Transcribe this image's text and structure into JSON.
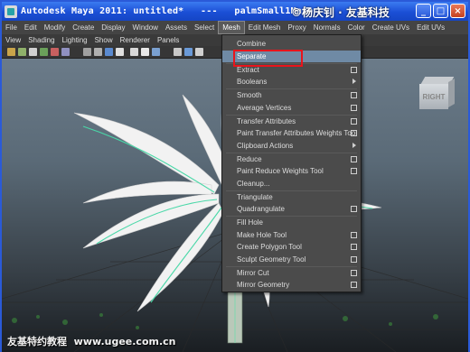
{
  "window": {
    "title": "Autodesk Maya 2011: untitled*   ---   palmSmall1Main",
    "watermark_top": "©杨庆钊 · 友基科技",
    "buttons": [
      "_",
      "□",
      "×"
    ]
  },
  "menubar": [
    "File",
    "Edit",
    "Modify",
    "Create",
    "Display",
    "Window",
    "Assets",
    "Select",
    "Mesh",
    "Edit Mesh",
    "Proxy",
    "Normals",
    "Color",
    "Create UVs",
    "Edit UVs"
  ],
  "active_menu": "Mesh",
  "panel_menu": [
    "View",
    "Shading",
    "Lighting",
    "Show",
    "Renderer",
    "Panels"
  ],
  "viewcube_label": "RIGHT",
  "footer_watermark": "友基特约教程  www.ugee.com.cn",
  "mesh_menu": {
    "items": [
      {
        "label": "Combine"
      },
      {
        "label": "Separate",
        "highlighted": true
      },
      {
        "label": "Extract",
        "option_box": true
      },
      {
        "label": "Booleans",
        "submenu": true
      },
      {
        "label": "Smooth",
        "option_box": true
      },
      {
        "label": "Average Vertices",
        "option_box": true
      },
      {
        "label": "Transfer Attributes",
        "option_box": true
      },
      {
        "label": "Paint Transfer Attributes Weights Tool",
        "option_box": true
      },
      {
        "label": "Clipboard Actions",
        "submenu": true
      },
      {
        "label": "Reduce",
        "option_box": true
      },
      {
        "label": "Paint Reduce Weights Tool",
        "option_box": true
      },
      {
        "label": "Cleanup...",
        "option_box": false
      },
      {
        "label": "Triangulate"
      },
      {
        "label": "Quadrangulate",
        "option_box": true
      },
      {
        "label": "Fill Hole"
      },
      {
        "label": "Make Hole Tool",
        "option_box": true
      },
      {
        "label": "Create Polygon Tool",
        "option_box": true
      },
      {
        "label": "Sculpt Geometry Tool",
        "option_box": true
      },
      {
        "label": "Mirror Cut",
        "option_box": true
      },
      {
        "label": "Mirror Geometry",
        "option_box": true
      }
    ]
  },
  "colors": {
    "highlight": "#6f8aa5",
    "callout": "#e8141c",
    "title_bar": "#1b4fd6"
  }
}
